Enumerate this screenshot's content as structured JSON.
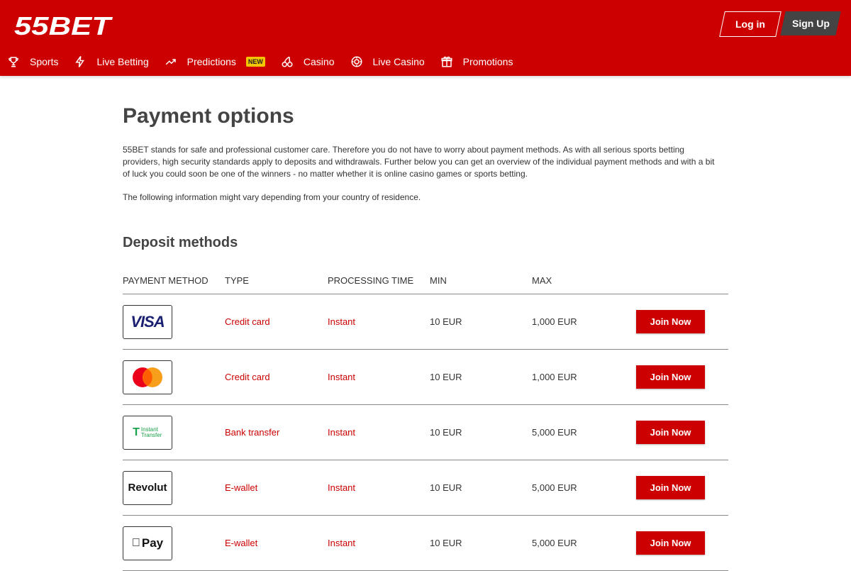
{
  "header": {
    "logo_text": "55BET",
    "login_label": "Log in",
    "signup_label": "Sign Up",
    "brand_color": "#cc0000"
  },
  "nav": {
    "items": [
      {
        "label": "Sports",
        "icon": "trophy-icon"
      },
      {
        "label": "Live Betting",
        "icon": "lightning-icon"
      },
      {
        "label": "Predictions",
        "icon": "trending-up-icon",
        "badge": "NEW"
      },
      {
        "label": "Casino",
        "icon": "cherries-icon"
      },
      {
        "label": "Live Casino",
        "icon": "chip-icon"
      },
      {
        "label": "Promotions",
        "icon": "gift-icon"
      }
    ]
  },
  "main": {
    "title": "Payment options",
    "paragraph1": "55BET stands for safe and professional customer care. Therefore you do not have to worry about payment methods. As with all serious sports betting providers, high security standards apply to deposits and withdrawals. Further below you can get an overview of the individual payment methods and with a bit of luck you could soon be one of the winners - no matter whether it is online casino games or sports betting.",
    "paragraph2": "The following information might vary depending from your country of residence.",
    "deposit_title": "Deposit methods",
    "columns": [
      "PAYMENT METHOD",
      "TYPE",
      "PROCESSING TIME",
      "MIN",
      "MAX"
    ],
    "rows": [
      {
        "logo": "VISA",
        "type": "Credit card",
        "time": "Instant",
        "min": "10 EUR",
        "max": "1,000 EUR",
        "action": "Join Now"
      },
      {
        "logo": "Mastercard",
        "type": "Credit card",
        "time": "Instant",
        "min": "10 EUR",
        "max": "1,000 EUR",
        "action": "Join Now"
      },
      {
        "logo": "Instant Transfer",
        "type": "Bank transfer",
        "time": "Instant",
        "min": "10 EUR",
        "max": "5,000 EUR",
        "action": "Join Now"
      },
      {
        "logo": "Revolut",
        "type": "E-wallet",
        "time": "Instant",
        "min": "10 EUR",
        "max": "5,000 EUR",
        "action": "Join Now"
      },
      {
        "logo": "Pay",
        "type": "E-wallet",
        "time": "Instant",
        "min": "10 EUR",
        "max": "5,000 EUR",
        "action": "Join Now"
      }
    ]
  }
}
